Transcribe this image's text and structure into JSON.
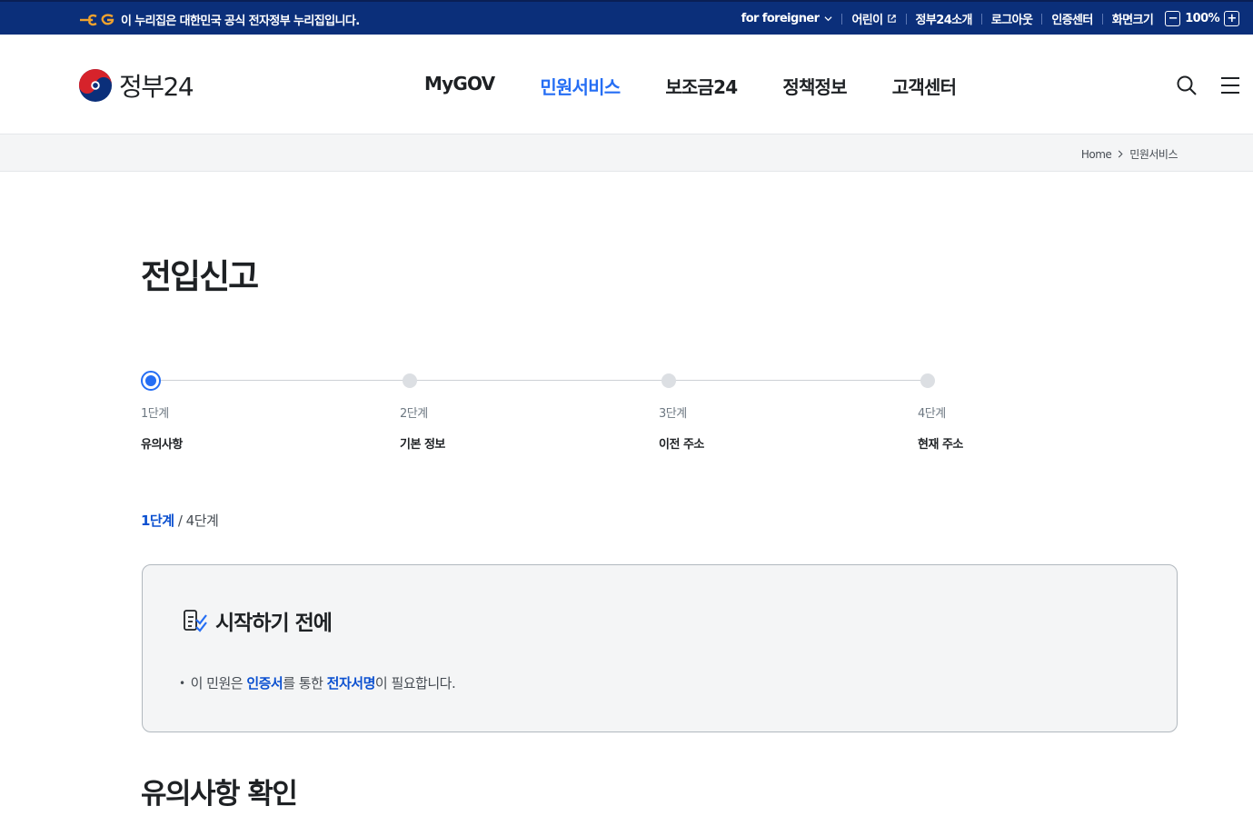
{
  "gov_banner": {
    "notice": "이 누리집은 대한민국 공식 전자정부 누리집입니다.",
    "for_foreigner": "for foreigner",
    "kids": "어린이",
    "about": "정부24소개",
    "logout": "로그아웃",
    "cert_center": "인증센터",
    "screen_size_label": "화면크기",
    "zoom_minus": "−",
    "zoom_value": "100%",
    "zoom_plus": "+"
  },
  "header": {
    "brand": "정부24",
    "nav": [
      "MyGOV",
      "민원서비스",
      "보조금24",
      "정책정보",
      "고객센터"
    ],
    "active_nav": "민원서비스"
  },
  "breadcrumb": {
    "home": "Home",
    "current": "민원서비스"
  },
  "page": {
    "title": "전입신고",
    "steps": [
      {
        "number": "1단계",
        "name": "유의사항",
        "state": "current"
      },
      {
        "number": "2단계",
        "name": "기본 정보",
        "state": "pending"
      },
      {
        "number": "3단계",
        "name": "이전 주소",
        "state": "pending"
      },
      {
        "number": "4단계",
        "name": "현재 주소",
        "state": "pending"
      }
    ],
    "step_counter": {
      "current": "1단계",
      "separator": "/",
      "total": "4단계"
    },
    "notice": {
      "title": "시작하기 전에",
      "bullet": "•",
      "text_1": "이 민원은 ",
      "highlight_1": "인증서",
      "text_2": "를 통한 ",
      "highlight_2": "전자서명",
      "text_3": "이 필요합니다."
    },
    "section_title": "유의사항 확인"
  },
  "colors": {
    "gov_bar": "#0b2f7a",
    "accent": "#256ef4",
    "highlight_text": "#0b50d0",
    "notice_bg": "#f4f5f6"
  },
  "icons": {
    "gov_logo": "eg-mark-icon",
    "emblem": "taegeuk-emblem-icon",
    "search": "search-icon",
    "menu": "hamburger-menu-icon",
    "notice": "checklist-icon",
    "external": "external-link-icon",
    "chevron": "chevron-down-icon"
  }
}
